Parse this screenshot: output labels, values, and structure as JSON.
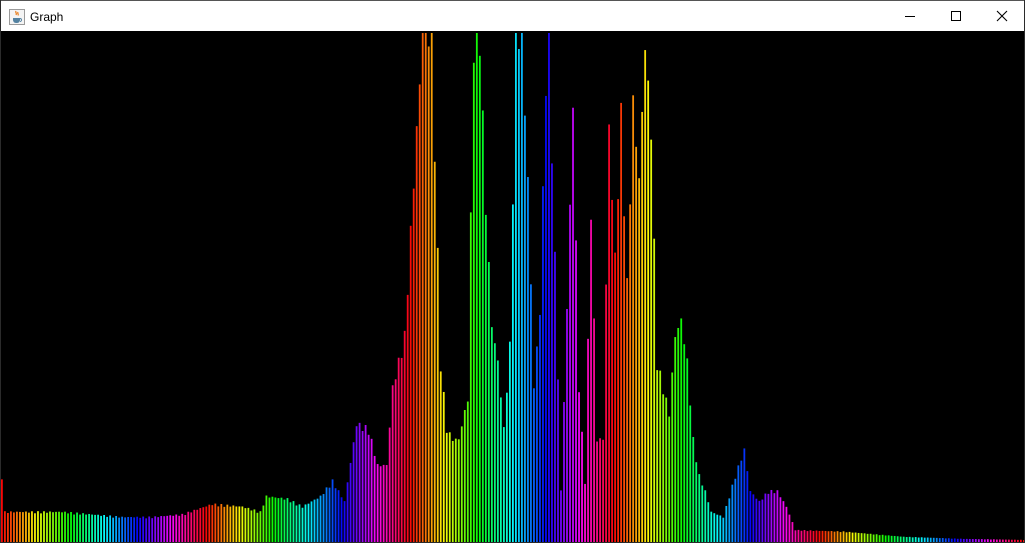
{
  "window": {
    "title": "Graph",
    "app_icon": "java-coffee-cup-icon",
    "controls": {
      "minimize_icon": "minimize-icon",
      "maximize_icon": "maximize-icon",
      "close_icon": "close-icon"
    }
  },
  "chart_data": {
    "type": "bar",
    "title": "",
    "xlabel": "",
    "ylabel": "",
    "background": "#000000",
    "bar_count": 341,
    "color_scheme": "rainbow-hue-cycle",
    "ylim": [
      0,
      1
    ],
    "grid": false,
    "legend": "none",
    "profile_points": [
      [
        0,
        0.13
      ],
      [
        1,
        0.06
      ],
      [
        10,
        0.06
      ],
      [
        20,
        0.06
      ],
      [
        30,
        0.055
      ],
      [
        40,
        0.05
      ],
      [
        50,
        0.05
      ],
      [
        60,
        0.055
      ],
      [
        70,
        0.075
      ],
      [
        80,
        0.07
      ],
      [
        86,
        0.06
      ],
      [
        88,
        0.09
      ],
      [
        95,
        0.085
      ],
      [
        100,
        0.07
      ],
      [
        106,
        0.09
      ],
      [
        110,
        0.12
      ],
      [
        114,
        0.08
      ],
      [
        118,
        0.23
      ],
      [
        122,
        0.22
      ],
      [
        125,
        0.15
      ],
      [
        128,
        0.15
      ],
      [
        130,
        0.3
      ],
      [
        134,
        0.4
      ],
      [
        137,
        0.7
      ],
      [
        140,
        0.985
      ],
      [
        143,
        0.97
      ],
      [
        146,
        0.35
      ],
      [
        148,
        0.22
      ],
      [
        150,
        0.2
      ],
      [
        152,
        0.2
      ],
      [
        155,
        0.28
      ],
      [
        157,
        0.97
      ],
      [
        159,
        0.985
      ],
      [
        161,
        0.65
      ],
      [
        163,
        0.42
      ],
      [
        165,
        0.35
      ],
      [
        167,
        0.22
      ],
      [
        169,
        0.38
      ],
      [
        171,
        1.0
      ],
      [
        173,
        0.98
      ],
      [
        175,
        0.7
      ],
      [
        177,
        0.3
      ],
      [
        179,
        0.45
      ],
      [
        181,
        0.9
      ],
      [
        182,
        0.99
      ],
      [
        184,
        0.55
      ],
      [
        186,
        0.1
      ],
      [
        188,
        0.45
      ],
      [
        190,
        0.85
      ],
      [
        192,
        0.3
      ],
      [
        194,
        0.12
      ],
      [
        196,
        0.65
      ],
      [
        198,
        0.2
      ],
      [
        200,
        0.2
      ],
      [
        202,
        0.8
      ],
      [
        204,
        0.55
      ],
      [
        206,
        0.83
      ],
      [
        208,
        0.5
      ],
      [
        210,
        0.85
      ],
      [
        212,
        0.7
      ],
      [
        214,
        0.96
      ],
      [
        216,
        0.8
      ],
      [
        218,
        0.35
      ],
      [
        220,
        0.3
      ],
      [
        222,
        0.25
      ],
      [
        224,
        0.4
      ],
      [
        226,
        0.43
      ],
      [
        228,
        0.35
      ],
      [
        230,
        0.2
      ],
      [
        232,
        0.13
      ],
      [
        234,
        0.1
      ],
      [
        236,
        0.06
      ],
      [
        240,
        0.05
      ],
      [
        244,
        0.13
      ],
      [
        247,
        0.18
      ],
      [
        249,
        0.1
      ],
      [
        252,
        0.08
      ],
      [
        255,
        0.1
      ],
      [
        258,
        0.1
      ],
      [
        261,
        0.07
      ],
      [
        264,
        0.025
      ],
      [
        280,
        0.022
      ],
      [
        300,
        0.012
      ],
      [
        320,
        0.008
      ],
      [
        340,
        0.006
      ]
    ]
  }
}
